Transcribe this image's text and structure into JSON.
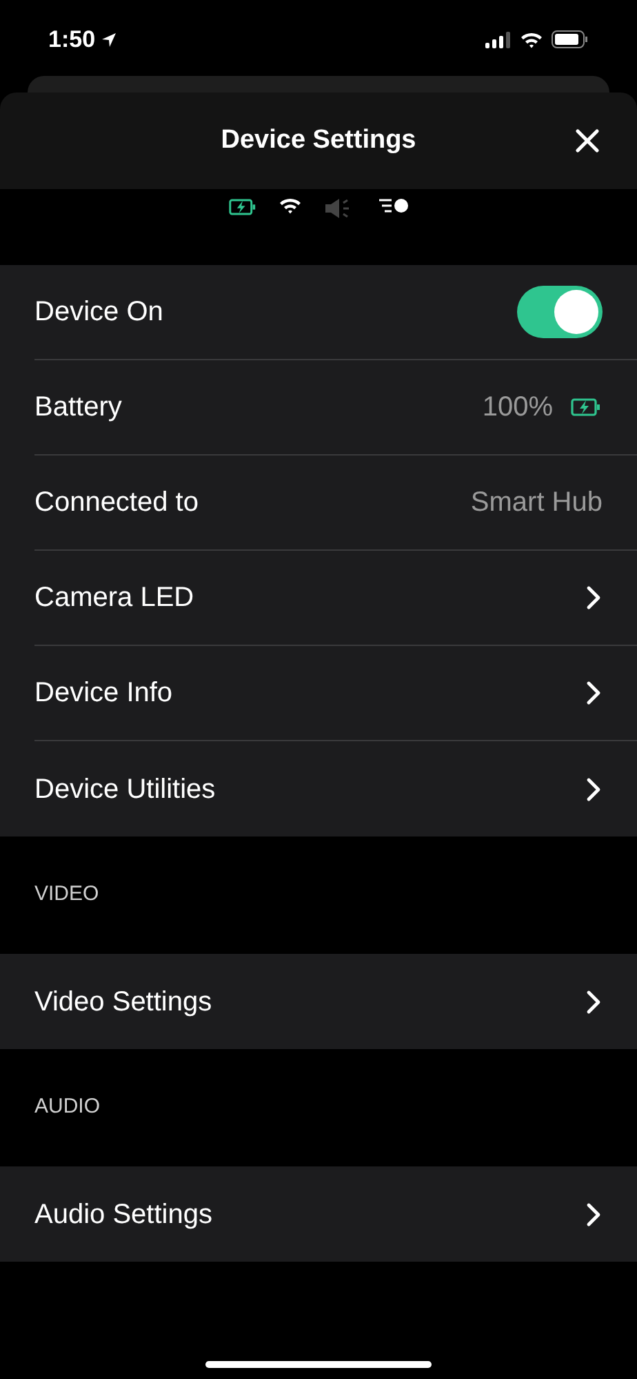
{
  "status_bar": {
    "time": "1:50"
  },
  "title": "Device Settings",
  "groups": [
    {
      "rows": [
        {
          "kind": "toggle",
          "label": "Device On",
          "on": true
        },
        {
          "kind": "battery",
          "label": "Battery",
          "value": "100%"
        },
        {
          "kind": "value",
          "label": "Connected to",
          "value": "Smart Hub"
        },
        {
          "kind": "link",
          "label": "Camera LED"
        },
        {
          "kind": "link",
          "label": "Device Info"
        },
        {
          "kind": "link",
          "label": "Device Utilities"
        }
      ]
    },
    {
      "header": "VIDEO",
      "rows": [
        {
          "kind": "link",
          "label": "Video Settings"
        }
      ]
    },
    {
      "header": "AUDIO",
      "rows": [
        {
          "kind": "link",
          "label": "Audio Settings"
        }
      ]
    }
  ]
}
